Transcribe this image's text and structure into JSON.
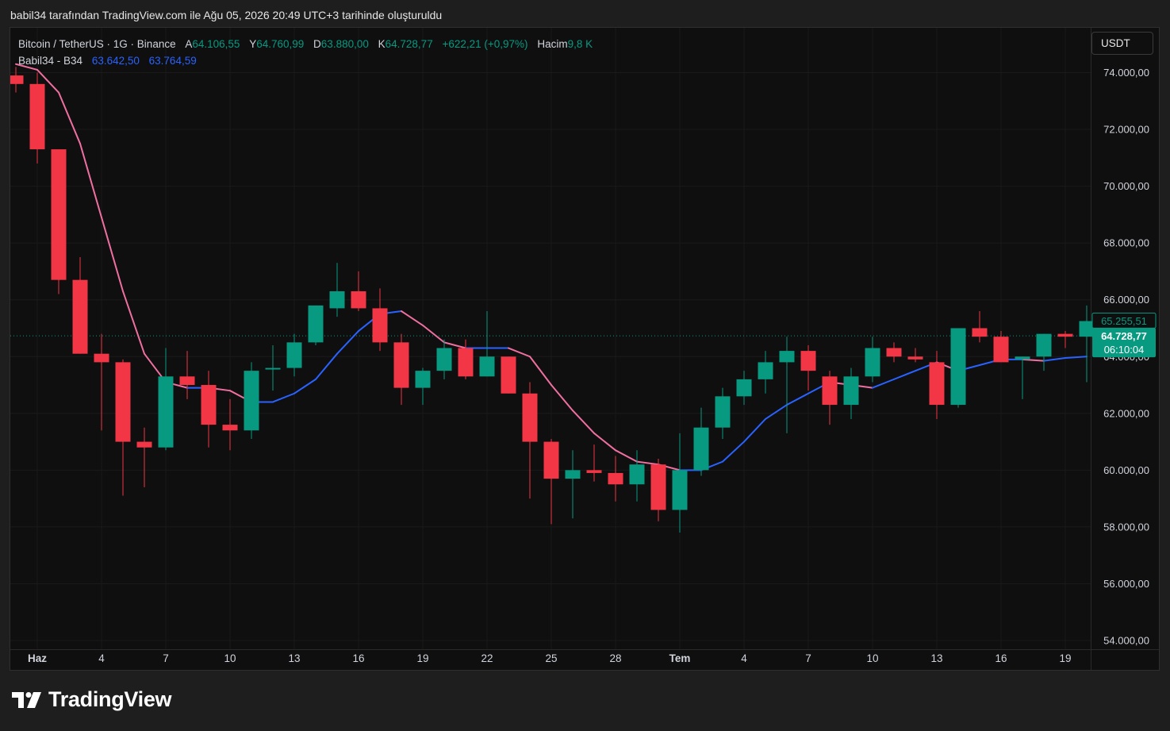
{
  "caption": "babil34 tarafından TradingView.com ile Ağu 05, 2026 20:49 UTC+3 tarihinde oluşturuldu",
  "legend": {
    "symbol": "Bitcoin / TetherUS · 1G · Binance",
    "open_label": "A",
    "open": "64.106,55",
    "high_label": "Y",
    "high": "64.760,99",
    "low_label": "D",
    "low": "63.880,00",
    "close_label": "K",
    "close": "64.728,77",
    "change": "+622,21 (+0,97%)",
    "volume_label": "Hacim",
    "volume": "9,8 K",
    "indicator_name": "Babil34 - B34",
    "indicator_value_1": "63.642,50",
    "indicator_value_2": "63.764,59"
  },
  "currency_button": "USDT",
  "brand": "TradingView",
  "colors": {
    "up": "#089981",
    "down": "#f23645",
    "line_up": "#2962ff",
    "line_down": "#ef6fa0",
    "background": "#0f0f0f",
    "grid": "#1a1a1a"
  },
  "chart_data": {
    "type": "candlestick",
    "title": "Bitcoin / TetherUS · 1G · Binance",
    "ylim": [
      54000,
      76000
    ],
    "y_ticks": [
      "74.000,00",
      "72.000,00",
      "70.000,00",
      "68.000,00",
      "66.000,00",
      "64.000,00",
      "62.000,00",
      "60.000,00",
      "58.000,00",
      "56.000,00",
      "54.000,00"
    ],
    "y_tick_values": [
      74000,
      72000,
      70000,
      68000,
      66000,
      64000,
      62000,
      60000,
      58000,
      56000,
      54000
    ],
    "x_ticks": [
      {
        "label": "Haz",
        "index": 1
      },
      {
        "label": "4",
        "index": 4
      },
      {
        "label": "7",
        "index": 7
      },
      {
        "label": "10",
        "index": 10
      },
      {
        "label": "13",
        "index": 13
      },
      {
        "label": "16",
        "index": 16
      },
      {
        "label": "19",
        "index": 19
      },
      {
        "label": "22",
        "index": 22
      },
      {
        "label": "25",
        "index": 25
      },
      {
        "label": "28",
        "index": 28
      },
      {
        "label": "Tem",
        "index": 31
      },
      {
        "label": "4",
        "index": 34
      },
      {
        "label": "7",
        "index": 37
      },
      {
        "label": "10",
        "index": 40
      },
      {
        "label": "13",
        "index": 43
      },
      {
        "label": "16",
        "index": 46
      },
      {
        "label": "19",
        "index": 49
      }
    ],
    "bold_x_labels": [
      "Haz",
      "Tem"
    ],
    "candles": [
      {
        "o": 73900,
        "h": 74200,
        "l": 73300,
        "c": 73600
      },
      {
        "o": 73600,
        "h": 74000,
        "l": 70800,
        "c": 71300
      },
      {
        "o": 71300,
        "h": 71300,
        "l": 66200,
        "c": 66700
      },
      {
        "o": 66700,
        "h": 67500,
        "l": 64100,
        "c": 64100
      },
      {
        "o": 64100,
        "h": 64800,
        "l": 61400,
        "c": 63800
      },
      {
        "o": 63800,
        "h": 63900,
        "l": 59100,
        "c": 61000
      },
      {
        "o": 61000,
        "h": 61500,
        "l": 59400,
        "c": 60800
      },
      {
        "o": 60800,
        "h": 64300,
        "l": 60700,
        "c": 63300
      },
      {
        "o": 63300,
        "h": 64200,
        "l": 62500,
        "c": 63000
      },
      {
        "o": 63000,
        "h": 63500,
        "l": 60800,
        "c": 61600
      },
      {
        "o": 61600,
        "h": 62500,
        "l": 60700,
        "c": 61400
      },
      {
        "o": 61400,
        "h": 63800,
        "l": 61100,
        "c": 63500
      },
      {
        "o": 63600,
        "h": 64400,
        "l": 62800,
        "c": 63600
      },
      {
        "o": 63600,
        "h": 64800,
        "l": 63300,
        "c": 64500
      },
      {
        "o": 64500,
        "h": 65800,
        "l": 64400,
        "c": 65800
      },
      {
        "o": 65700,
        "h": 67300,
        "l": 65400,
        "c": 66300
      },
      {
        "o": 66300,
        "h": 67000,
        "l": 65600,
        "c": 65700
      },
      {
        "o": 65700,
        "h": 66400,
        "l": 64200,
        "c": 64500
      },
      {
        "o": 64500,
        "h": 64800,
        "l": 62300,
        "c": 62900
      },
      {
        "o": 62900,
        "h": 63600,
        "l": 62300,
        "c": 63500
      },
      {
        "o": 63500,
        "h": 64600,
        "l": 63200,
        "c": 64300
      },
      {
        "o": 64300,
        "h": 64600,
        "l": 63200,
        "c": 63300
      },
      {
        "o": 63300,
        "h": 65600,
        "l": 63300,
        "c": 64000
      },
      {
        "o": 64000,
        "h": 64000,
        "l": 62700,
        "c": 62700
      },
      {
        "o": 62700,
        "h": 63100,
        "l": 59000,
        "c": 61000
      },
      {
        "o": 61000,
        "h": 61100,
        "l": 58100,
        "c": 59700
      },
      {
        "o": 59700,
        "h": 60700,
        "l": 58300,
        "c": 60000
      },
      {
        "o": 60000,
        "h": 60900,
        "l": 59600,
        "c": 59900
      },
      {
        "o": 59900,
        "h": 60500,
        "l": 58900,
        "c": 59500
      },
      {
        "o": 59500,
        "h": 60700,
        "l": 58900,
        "c": 60200
      },
      {
        "o": 60200,
        "h": 60400,
        "l": 58200,
        "c": 58600
      },
      {
        "o": 58600,
        "h": 61300,
        "l": 57800,
        "c": 60000
      },
      {
        "o": 60000,
        "h": 62200,
        "l": 59800,
        "c": 61500
      },
      {
        "o": 61500,
        "h": 62900,
        "l": 61100,
        "c": 62600
      },
      {
        "o": 62600,
        "h": 63500,
        "l": 62300,
        "c": 63200
      },
      {
        "o": 63200,
        "h": 64200,
        "l": 62700,
        "c": 63800
      },
      {
        "o": 63800,
        "h": 64700,
        "l": 61300,
        "c": 64200
      },
      {
        "o": 64200,
        "h": 64400,
        "l": 62800,
        "c": 63500
      },
      {
        "o": 63300,
        "h": 63500,
        "l": 61600,
        "c": 62300
      },
      {
        "o": 62300,
        "h": 63600,
        "l": 61800,
        "c": 63300
      },
      {
        "o": 63300,
        "h": 64700,
        "l": 63100,
        "c": 64300
      },
      {
        "o": 64300,
        "h": 64500,
        "l": 63800,
        "c": 64000
      },
      {
        "o": 64000,
        "h": 64300,
        "l": 63800,
        "c": 63900
      },
      {
        "o": 63800,
        "h": 64200,
        "l": 61800,
        "c": 62300
      },
      {
        "o": 62300,
        "h": 65000,
        "l": 62200,
        "c": 65000
      },
      {
        "o": 65000,
        "h": 65600,
        "l": 64500,
        "c": 64700
      },
      {
        "o": 64700,
        "h": 64900,
        "l": 63800,
        "c": 63800
      },
      {
        "o": 63900,
        "h": 64000,
        "l": 62500,
        "c": 64000
      },
      {
        "o": 64000,
        "h": 64800,
        "l": 63500,
        "c": 64800
      },
      {
        "o": 64800,
        "h": 64900,
        "l": 64300,
        "c": 64700
      },
      {
        "o": 64700,
        "h": 65800,
        "l": 63100,
        "c": 65250
      }
    ],
    "indicator": {
      "name": "Babil34 - B34",
      "values": [
        74300,
        74100,
        73300,
        71500,
        68900,
        66300,
        64100,
        63100,
        62900,
        62900,
        62800,
        62400,
        62400,
        62700,
        63200,
        64100,
        64900,
        65500,
        65600,
        65100,
        64500,
        64300,
        64300,
        64300,
        64000,
        63000,
        62100,
        61300,
        60700,
        60300,
        60200,
        60000,
        60000,
        60300,
        61000,
        61800,
        62300,
        62700,
        63100,
        63000,
        62900,
        63200,
        63500,
        63800,
        63500,
        63700,
        63900,
        63900,
        63850,
        63950,
        64000
      ]
    },
    "price_labels": {
      "high_marker": "65.255,51",
      "last_price": "64.728,77",
      "countdown": "06:10:04",
      "last_price_value": 64728.77,
      "high_marker_value": 65255.51
    }
  }
}
